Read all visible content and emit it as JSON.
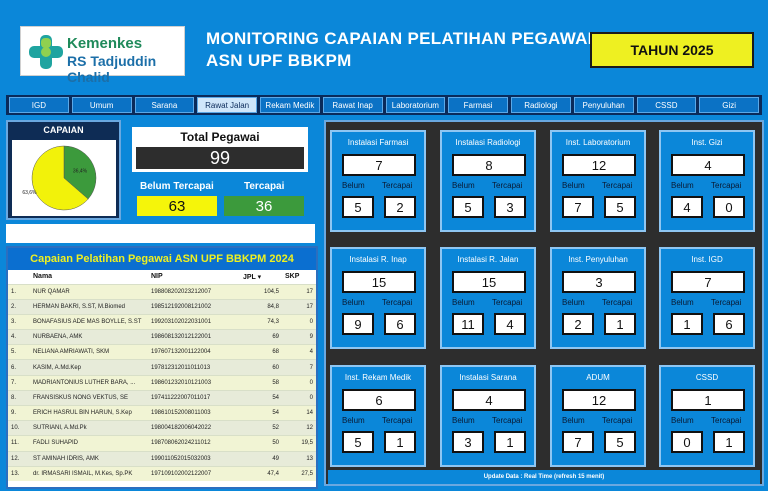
{
  "header": {
    "logo_line1": "Kemenkes",
    "logo_line2": "RS Tadjuddin Chalid",
    "title_line1": "MONITORING CAPAIAN PELATIHAN PEGAWAI",
    "title_line2": "ASN UPF BBKPM",
    "year_label": "TAHUN 2025"
  },
  "nav": [
    {
      "label": "IGD"
    },
    {
      "label": "Umum"
    },
    {
      "label": "Sarana"
    },
    {
      "label": "Rawat Jalan",
      "active": true
    },
    {
      "label": "Rekam Medik"
    },
    {
      "label": "Rawat Inap"
    },
    {
      "label": "Laboratorium"
    },
    {
      "label": "Farmasi"
    },
    {
      "label": "Radiologi"
    },
    {
      "label": "Penyuluhan"
    },
    {
      "label": "CSSD"
    },
    {
      "label": "Gizi"
    }
  ],
  "capaian": {
    "title": "CAPAIAN",
    "slices": [
      {
        "label": "36,4%",
        "value": 36.4,
        "color": "#3c9a3c"
      },
      {
        "label": "63,6%",
        "value": 63.6,
        "color": "#f2f20a"
      }
    ]
  },
  "summary": {
    "total_label": "Total Pegawai",
    "total_value": "99",
    "belum_label": "Belum Tercapai",
    "belum_value": "63",
    "tercapai_label": "Tercapai",
    "tercapai_value": "36"
  },
  "table": {
    "title": "Capaian Pelatihan Pegawai ASN UPF BBKPM 2024",
    "headers": {
      "no": "",
      "nama": "Nama",
      "nip": "NIP",
      "jpl": "JPL",
      "skp": "SKP"
    },
    "rows": [
      {
        "no": "1.",
        "nama": "NUR QAMAR",
        "nip": "198808202023212007",
        "jpl": "104,5",
        "skp": "17"
      },
      {
        "no": "2.",
        "nama": "HERMAN BAKRI, S.ST, M.Biomed",
        "nip": "198512192008121002",
        "jpl": "84,8",
        "skp": "17"
      },
      {
        "no": "3.",
        "nama": "BONAFASIUS ADE MAS BOYLLE, S.ST",
        "nip": "199203102022031001",
        "jpl": "74,3",
        "skp": "0"
      },
      {
        "no": "4.",
        "nama": "NURBAENA, AMK",
        "nip": "198608132012122001",
        "jpl": "69",
        "skp": "9"
      },
      {
        "no": "5.",
        "nama": "NELIANA AMRIAWATI, SKM",
        "nip": "197607132001122004",
        "jpl": "68",
        "skp": "4"
      },
      {
        "no": "6.",
        "nama": "KASIM, A.Md.Kep",
        "nip": "197812312011011013",
        "jpl": "60",
        "skp": "7"
      },
      {
        "no": "7.",
        "nama": "MADRIANTONIUS LUTHER BARA, ...",
        "nip": "198601232010121003",
        "jpl": "58",
        "skp": "0"
      },
      {
        "no": "8.",
        "nama": "FRANSISKUS NONG VEKTUS, SE",
        "nip": "197411222007011017",
        "jpl": "54",
        "skp": "0"
      },
      {
        "no": "9.",
        "nama": "ERICH HASRUL BIN HARUN, S.Kep",
        "nip": "198610152008011003",
        "jpl": "54",
        "skp": "14"
      },
      {
        "no": "10.",
        "nama": "SUTRIANI, A.Md.Pk",
        "nip": "198004182006042022",
        "jpl": "52",
        "skp": "12"
      },
      {
        "no": "11.",
        "nama": "FADLI SUHAPID",
        "nip": "198708062024211012",
        "jpl": "50",
        "skp": "19,5"
      },
      {
        "no": "12.",
        "nama": "ST AMINAH IDRIS, AMK",
        "nip": "199011052015032003",
        "jpl": "49",
        "skp": "13"
      },
      {
        "no": "13.",
        "nama": "dr. IRMASARI ISMAIL, M.Kes, Sp.PK",
        "nip": "197109102002122007",
        "jpl": "47,4",
        "skp": "27,5"
      }
    ]
  },
  "cards": [
    {
      "name": "Instalasi Farmasi",
      "total": "7",
      "belum": "5",
      "tercapai": "2"
    },
    {
      "name": "Instalasi Radiologi",
      "total": "8",
      "belum": "5",
      "tercapai": "3"
    },
    {
      "name": "Inst. Laboratorium",
      "total": "12",
      "belum": "7",
      "tercapai": "5"
    },
    {
      "name": "Inst. Gizi",
      "total": "4",
      "belum": "4",
      "tercapai": "0"
    },
    {
      "name": "Instalasi R. Inap",
      "total": "15",
      "belum": "9",
      "tercapai": "6"
    },
    {
      "name": "Instalasi R. Jalan",
      "total": "15",
      "belum": "11",
      "tercapai": "4"
    },
    {
      "name": "Inst. Penyuluhan",
      "total": "3",
      "belum": "2",
      "tercapai": "1"
    },
    {
      "name": "Inst. IGD",
      "total": "7",
      "belum": "1",
      "tercapai": "6"
    },
    {
      "name": "Inst. Rekam Medik",
      "total": "6",
      "belum": "5",
      "tercapai": "1"
    },
    {
      "name": "Instalasi Sarana",
      "total": "4",
      "belum": "3",
      "tercapai": "1"
    },
    {
      "name": "ADUM",
      "total": "12",
      "belum": "7",
      "tercapai": "5"
    },
    {
      "name": "CSSD",
      "total": "1",
      "belum": "0",
      "tercapai": "1"
    }
  ],
  "card_labels": {
    "belum": "Belum",
    "tercapai": "Tercapai"
  },
  "footer": {
    "update_text": "Update Data : Real Time (refresh 15 menit)"
  }
}
